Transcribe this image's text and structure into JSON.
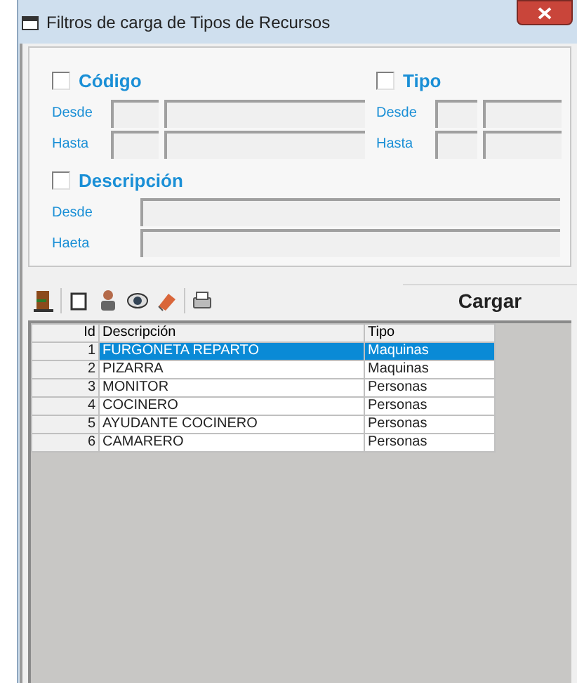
{
  "window": {
    "title": "Filtros de carga de Tipos de Recursos"
  },
  "filters": [
    {
      "label": "Código",
      "checked": false,
      "rows": [
        {
          "label": "Desde"
        },
        {
          "label": "Hasta"
        }
      ]
    },
    {
      "label": "Tipo",
      "checked": false,
      "rows": [
        {
          "label": "Desde"
        },
        {
          "label": "Hasta"
        }
      ]
    }
  ],
  "description_filter": {
    "label": "Descripción",
    "checked": false,
    "rows": [
      {
        "label": "Desde"
      },
      {
        "label": "Haeta"
      }
    ]
  },
  "load_button": "Cargar",
  "table": {
    "columns": [
      "Id",
      "Descripción",
      "Tipo"
    ],
    "rows": [
      {
        "cells": [
          "1",
          "FURGONETA REPARTO",
          "Maquinas"
        ],
        "selected": true
      },
      {
        "cells": [
          "2",
          "PIZARRA",
          "Maquinas"
        ],
        "selected": false
      },
      {
        "cells": [
          "3",
          "MONITOR",
          "Personas"
        ],
        "selected": false
      },
      {
        "cells": [
          "4",
          "COCINERO",
          "Personas"
        ],
        "selected": false
      },
      {
        "cells": [
          "5",
          "AYUDANTE COCINERO",
          "Personas"
        ],
        "selected": false
      },
      {
        "cells": [
          "6",
          "CAMARERO",
          "Personas"
        ],
        "selected": false
      }
    ]
  }
}
